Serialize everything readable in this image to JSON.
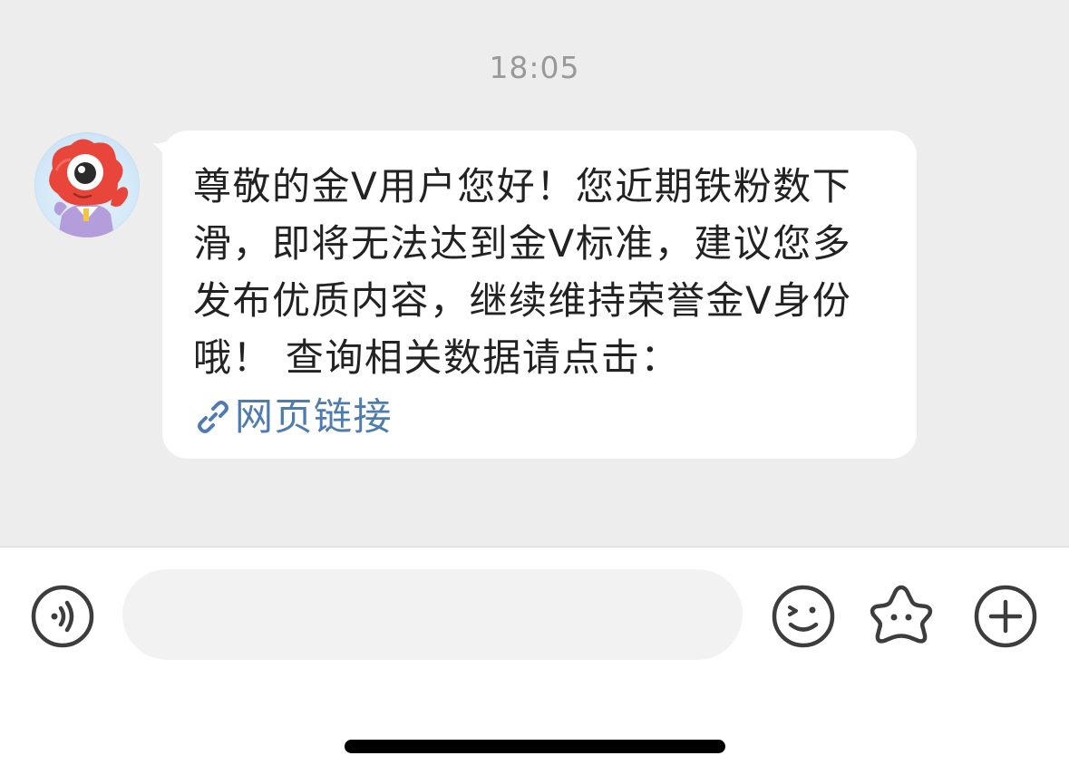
{
  "chat": {
    "timestamp": "18:05",
    "message": {
      "text": "尊敬的金V用户您好！您近期铁粉数下滑，即将无法达到金V标准，建议您多发布优质内容，继续维持荣誉金V身份哦！ 查询相关数据请点击：",
      "link_label": "网页链接"
    },
    "avatar_icon": "weibo-mascot-avatar",
    "colors": {
      "background": "#ededed",
      "bubble": "#ffffff",
      "text": "#222222",
      "timestamp": "#999999",
      "link": "#4e7cae"
    }
  },
  "input_bar": {
    "voice_icon": "voice-icon",
    "input_value": "",
    "emoji_icon": "emoji-icon",
    "sticker_icon": "sticker-icon",
    "plus_icon": "plus-icon"
  }
}
